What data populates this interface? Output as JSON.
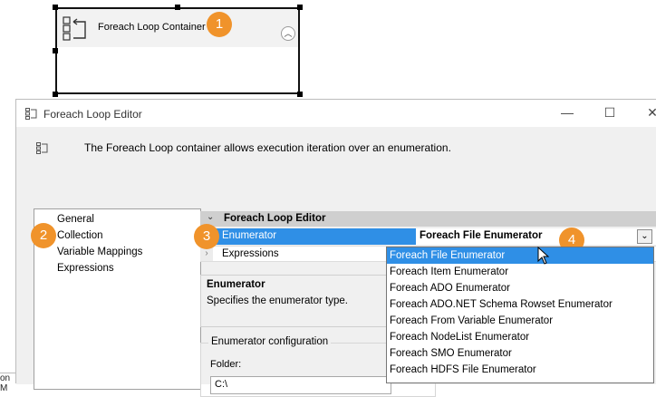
{
  "canvas": {
    "container_title": "Foreach Loop Container",
    "collapse_icon": "chevron-up-icon",
    "fragment_text": "on M"
  },
  "callouts": [
    "1",
    "2",
    "3",
    "4"
  ],
  "editor": {
    "title": "Foreach Loop Editor",
    "description": "The Foreach Loop container allows execution iteration over an enumeration.",
    "nav_items": [
      "General",
      "Collection",
      "Variable Mappings",
      "Expressions"
    ],
    "grid": {
      "header": "Foreach Loop Editor",
      "enumerator_label": "Enumerator",
      "enumerator_value": "Foreach File Enumerator",
      "expressions_label": "Expressions"
    },
    "info": {
      "title": "Enumerator",
      "description": "Specifies the enumerator type."
    },
    "config": {
      "group_label": "Enumerator configuration",
      "folder_label": "Folder:",
      "folder_value": "C:\\"
    },
    "dropdown_options": [
      "Foreach File Enumerator",
      "Foreach Item Enumerator",
      "Foreach ADO Enumerator",
      "Foreach ADO.NET Schema Rowset Enumerator",
      "Foreach From Variable Enumerator",
      "Foreach NodeList Enumerator",
      "Foreach SMO Enumerator",
      "Foreach HDFS File Enumerator"
    ],
    "selected_option": "Foreach File Enumerator"
  },
  "colors": {
    "accent": "#2f8fe6",
    "callout": "#f0932b"
  }
}
